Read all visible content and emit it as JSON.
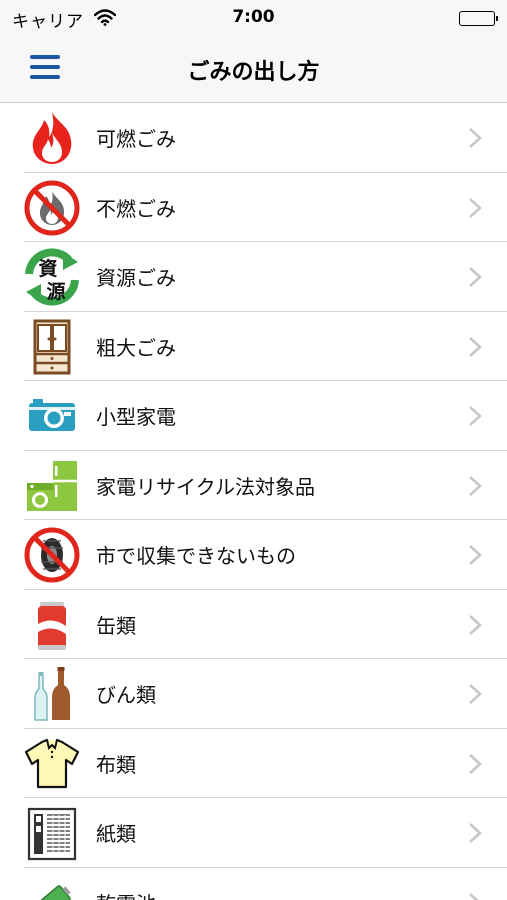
{
  "status_bar": {
    "carrier": "キャリア",
    "time": "7:00"
  },
  "nav": {
    "title": "ごみの出し方"
  },
  "items": [
    {
      "label": "可燃ごみ",
      "icon": "flame-icon"
    },
    {
      "label": "不燃ごみ",
      "icon": "no-burn-icon"
    },
    {
      "label": "資源ごみ",
      "icon": "recycle-resources-icon"
    },
    {
      "label": "粗大ごみ",
      "icon": "cabinet-icon"
    },
    {
      "label": "小型家電",
      "icon": "camera-icon"
    },
    {
      "label": "家電リサイクル法対象品",
      "icon": "appliances-icon"
    },
    {
      "label": "市で収集できないもの",
      "icon": "no-tire-icon"
    },
    {
      "label": "缶類",
      "icon": "can-icon"
    },
    {
      "label": "びん類",
      "icon": "bottles-icon"
    },
    {
      "label": "布類",
      "icon": "shirt-icon"
    },
    {
      "label": "紙類",
      "icon": "newspaper-icon"
    },
    {
      "label": "乾電池",
      "icon": "battery-icon"
    }
  ],
  "icon_texts": {
    "resource_top": "資",
    "resource_bottom": "源"
  },
  "colors": {
    "accent": "#1e56a6",
    "chevron": "#c7c7cc",
    "separator": "#d6d6da"
  }
}
